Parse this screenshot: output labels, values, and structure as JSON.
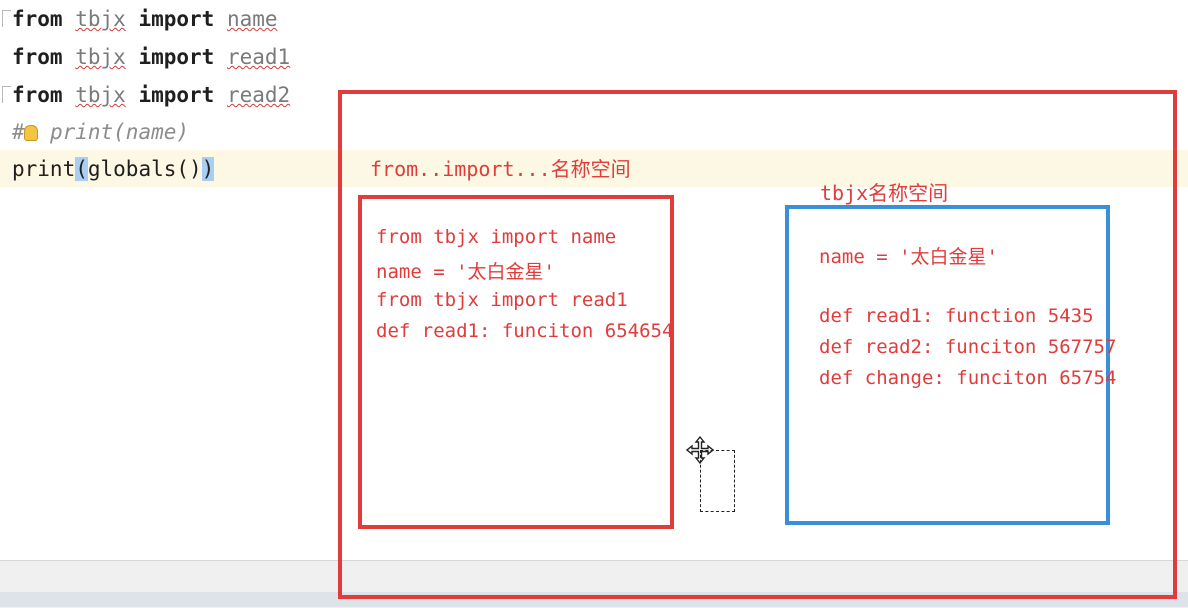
{
  "code": {
    "line1": {
      "kw1": "from",
      "mod": "tbjx",
      "kw2": "import",
      "name": "name"
    },
    "line2": {
      "kw1": "from",
      "mod": "tbjx",
      "kw2": "import",
      "name": "read1"
    },
    "line3": {
      "kw1": "from",
      "mod": "tbjx",
      "kw2": "import",
      "name": "read2"
    },
    "line4": {
      "hash": "#",
      "text": "print(name)"
    },
    "line5": {
      "func": "print",
      "open": "(",
      "inner": "globals()",
      "close": ")"
    }
  },
  "annotations": {
    "outer_title": "from..import...名称空间",
    "right_title": "tbjx名称空间",
    "left_lines": [
      "from tbjx import name",
      "name = '太白金星'",
      "from tbjx import read1",
      "def read1: funciton 654654"
    ],
    "right_lines": [
      "name = '太白金星'",
      "",
      "def read1: function 5435",
      "def read2: funciton 567757",
      "def change: funciton 65754"
    ]
  },
  "colors": {
    "annotation_red": "#e03c3c",
    "annotation_blue": "#3b8fd8",
    "line_highlight": "#fdf8e3"
  },
  "icons": {
    "cursor": "move-cursor-icon",
    "bulb": "lightbulb-icon"
  }
}
